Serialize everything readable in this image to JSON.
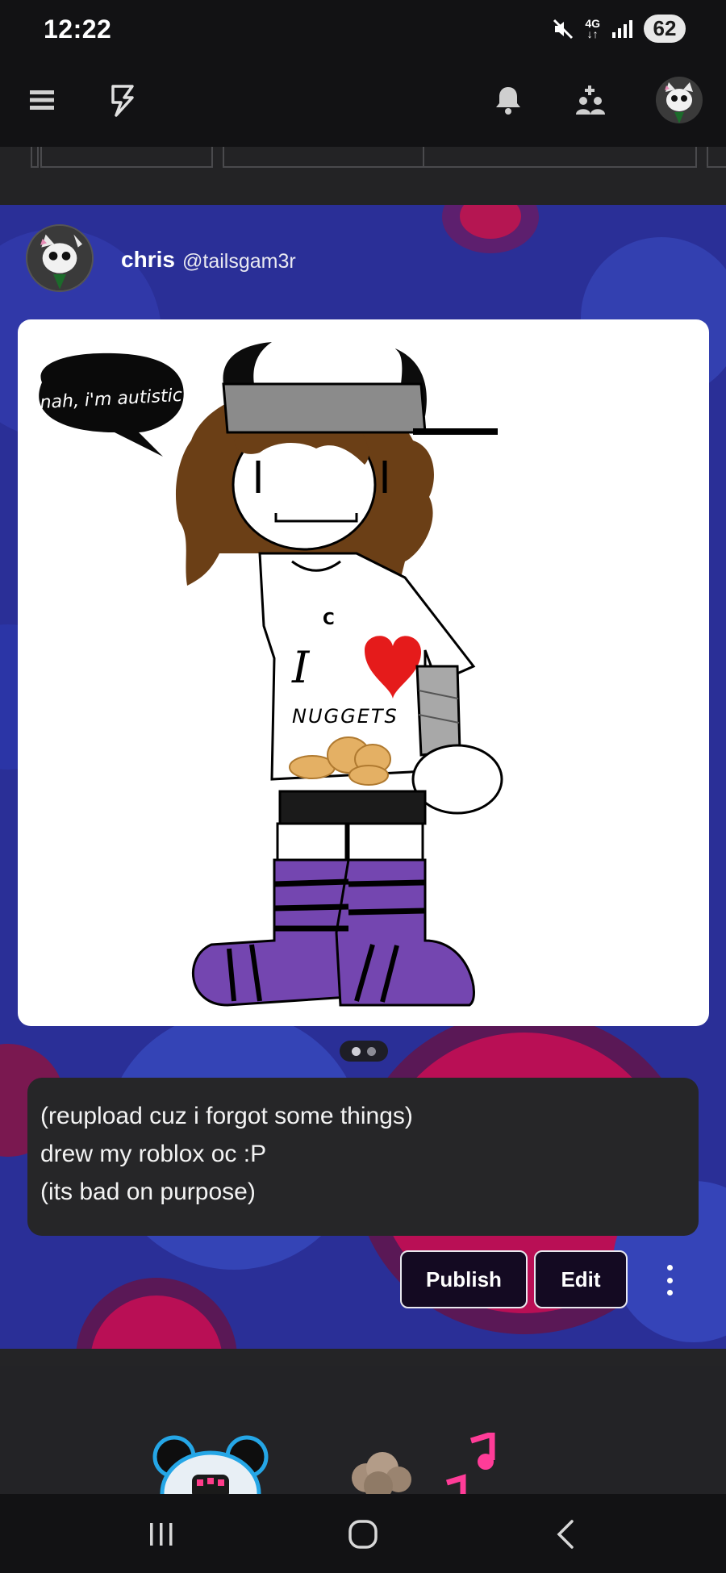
{
  "status_bar": {
    "time": "12:22",
    "network": "4G",
    "battery": "62",
    "icons": [
      "mute-icon",
      "network-arrows-icon",
      "signal-icon",
      "battery-icon"
    ]
  },
  "header": {
    "icons": [
      "menu-icon",
      "lightning-icon",
      "bell-icon",
      "add-friend-icon",
      "profile-avatar"
    ]
  },
  "post": {
    "author_name": "chris",
    "author_handle": "@tailsgam3r",
    "image": {
      "speech_bubble": "nah, i'm autistic",
      "shirt_text_i": "I",
      "shirt_text_bottom": "NUGGETS",
      "necklace_letter": "C"
    },
    "carousel": {
      "count": 2,
      "active_index": 0
    },
    "caption_lines": [
      "(reupload cuz i forgot some things)",
      "drew my roblox oc :P",
      "(its bad on purpose)"
    ],
    "actions": {
      "publish_label": "Publish",
      "edit_label": "Edit"
    }
  },
  "nav_bar": {
    "icons": [
      "recent-apps-icon",
      "home-icon",
      "back-icon"
    ]
  },
  "colors": {
    "background": "#1b1b1d",
    "post_background": "#2a2f97",
    "accent_pink": "#c4124e",
    "button_bg": "#140a22",
    "purple_sock": "#7446b0"
  }
}
